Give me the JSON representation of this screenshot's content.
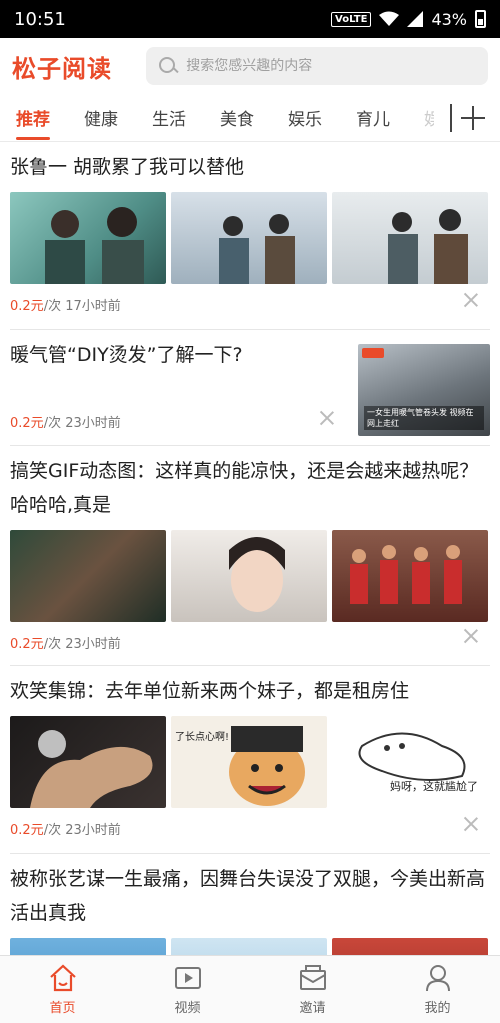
{
  "status_bar": {
    "time": "10:51",
    "network": "VoLTE",
    "battery": "43%"
  },
  "header": {
    "logo": "松子阅读",
    "search_placeholder": "搜索您感兴趣的内容"
  },
  "tabs": [
    {
      "label": "推荐",
      "active": true
    },
    {
      "label": "健康",
      "active": false
    },
    {
      "label": "生活",
      "active": false
    },
    {
      "label": "美食",
      "active": false
    },
    {
      "label": "娱乐",
      "active": false
    },
    {
      "label": "育儿",
      "active": false
    },
    {
      "label": "娱",
      "active": false
    }
  ],
  "articles": [
    {
      "title": "张鲁一 胡歌累了我可以替他",
      "price": "0.2元",
      "meta": "/次 17小时前",
      "thumbs": [
        "#6aa9a3",
        "#b9c6cf",
        "#d9dde0"
      ]
    },
    {
      "title": "暖气管“DIY烫发”了解一下?",
      "price": "0.2元",
      "meta": "/次 23小时前",
      "thumb_caption": "一女生用暖气管卷头发 视频在网上走红",
      "thumbs": [
        "#8d939a"
      ]
    },
    {
      "title": "搞笑GIF动态图：这样真的能凉快，还是会越来越热呢？哈哈哈,真是",
      "price": "0.2元",
      "meta": "/次 23小时前",
      "thumbs": [
        "#4b3e33",
        "#d8d2cc",
        "#7a2c22"
      ]
    },
    {
      "title": "欢笑集锦：去年单位新来两个妹子，都是租房住",
      "price": "0.2元",
      "meta": "/次 23小时前",
      "thumb_captions": [
        "",
        "了长点心啊!",
        "妈呀，这就尴尬了"
      ],
      "thumbs": [
        "#2d2a29",
        "#e7c49a",
        "#ffffff"
      ]
    },
    {
      "title": "被称张艺谋一生最痛，因舞台失误没了双腿，今美出新高活出真我",
      "price": "",
      "meta": "",
      "thumbs": [
        "#5ea0cf",
        "#b7d7ea",
        "#b03a2f"
      ]
    }
  ],
  "bottom_nav": [
    {
      "label": "首页",
      "icon": "home-icon",
      "active": true
    },
    {
      "label": "视频",
      "icon": "video-icon",
      "active": false
    },
    {
      "label": "邀请",
      "icon": "invite-icon",
      "active": false
    },
    {
      "label": "我的",
      "icon": "profile-icon",
      "active": false
    }
  ],
  "colors": {
    "accent": "#e94b2a",
    "text": "#222222",
    "muted": "#777777"
  }
}
